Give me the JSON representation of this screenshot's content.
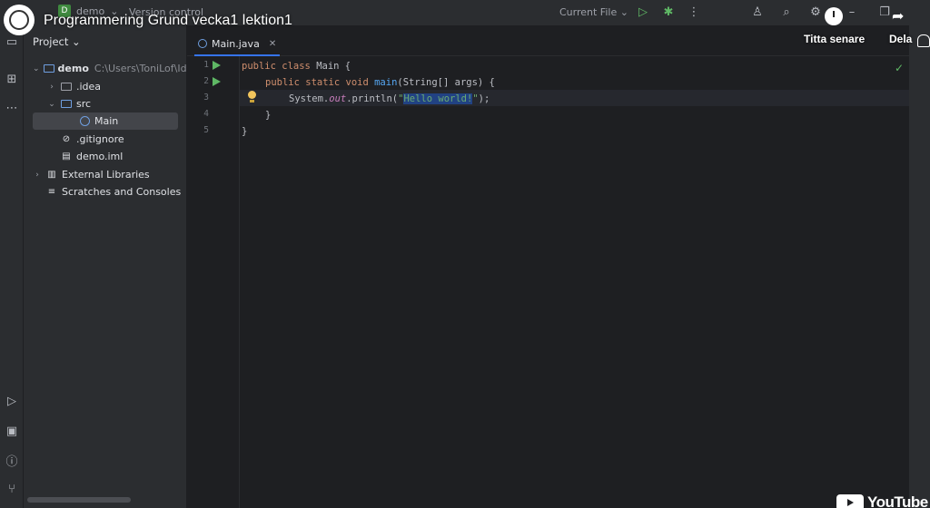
{
  "video": {
    "title": "Programmering Grund vecka1 lektion1",
    "watch_later": "Titta senare",
    "share": "Dela",
    "watermark": "YouTube"
  },
  "titlebar": {
    "project_badge": "D",
    "project_name": "demo",
    "version_control": "Version control",
    "run_config": "Current File"
  },
  "project_panel": {
    "header": "Project",
    "tree": [
      {
        "label": "demo",
        "path": "C:\\Users\\ToniLof\\Ide"
      },
      {
        "label": ".idea"
      },
      {
        "label": "src"
      },
      {
        "label": "Main"
      },
      {
        "label": ".gitignore"
      },
      {
        "label": "demo.iml"
      },
      {
        "label": "External Libraries"
      },
      {
        "label": "Scratches and Consoles"
      }
    ]
  },
  "editor": {
    "tab_label": "Main.java",
    "line_numbers": [
      "1",
      "2",
      "3",
      "4",
      "5"
    ],
    "code": {
      "l1_kw": "public class ",
      "l1_rest": "Main {",
      "l2_kw": "public static void ",
      "l2_fn": "main",
      "l2_rest": "(String[] args) {",
      "l3_a": "System.",
      "l3_field": "out",
      "l3_b": ".println(",
      "l3_q1": "\"",
      "l3_sel": "Hello world!",
      "l3_q2": "\"",
      "l3_c": ");",
      "l4": "}",
      "l5": "}"
    }
  },
  "colors": {
    "background": "#1e1f22",
    "panel": "#2b2d30",
    "keyword": "#cf8e6d",
    "function": "#56a8f5",
    "string": "#6aab73",
    "accent": "#3574f0"
  }
}
